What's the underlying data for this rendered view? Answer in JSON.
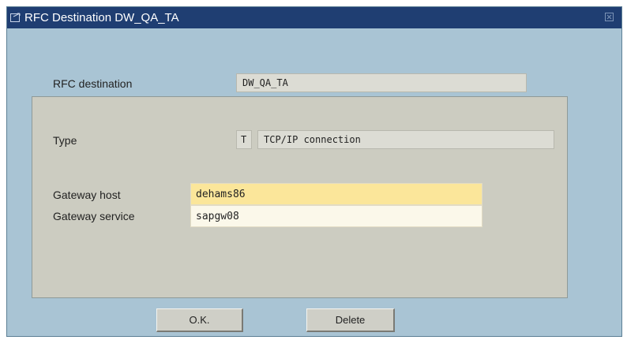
{
  "window": {
    "title": "RFC Destination DW_QA_TA"
  },
  "destination": {
    "label": "RFC destination",
    "value": "DW_QA_TA"
  },
  "connection": {
    "type_label": "Type",
    "type_code": "T",
    "type_text": "TCP/IP connection",
    "gateway_host_label": "Gateway host",
    "gateway_host_value": "dehams86",
    "gateway_service_label": "Gateway service",
    "gateway_service_value": "sapgw08"
  },
  "buttons": {
    "ok_label": "O.K.",
    "delete_label": "Delete"
  },
  "colors": {
    "titlebar": "#1f3e72",
    "window_background": "#a9c4d4",
    "group_panel": "#ccccc1",
    "focused_input": "#fbe69a"
  },
  "icons": {
    "title": "window-icon",
    "close": "close-icon"
  }
}
